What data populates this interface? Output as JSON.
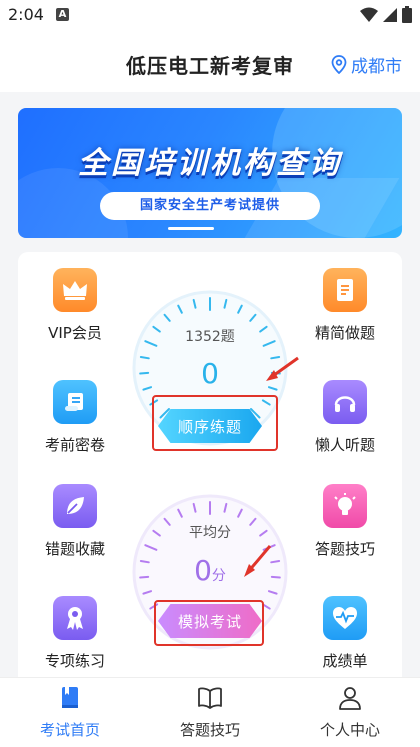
{
  "status": {
    "time": "2:04",
    "notification_glyph": "A"
  },
  "header": {
    "title": "低压电工新考复审",
    "location": "成都市"
  },
  "banner": {
    "title": "全国培训机构查询",
    "subtitle": "国家安全生产考试提供"
  },
  "grid": {
    "vip": "VIP会员",
    "concise": "精简做题",
    "pre_exam": "考前密卷",
    "lazy_listen": "懒人听题",
    "wrong_fav": "错题收藏",
    "tips": "答题技巧",
    "special": "专项练习",
    "score": "成绩单"
  },
  "practice_dial": {
    "count": "1352题",
    "value": "0",
    "button": "顺序练题"
  },
  "exam_dial": {
    "caption": "平均分",
    "value": "0",
    "unit": "分",
    "button": "模拟考试"
  },
  "tabbar": {
    "home": "考试首页",
    "tips": "答题技巧",
    "profile": "个人中心"
  }
}
